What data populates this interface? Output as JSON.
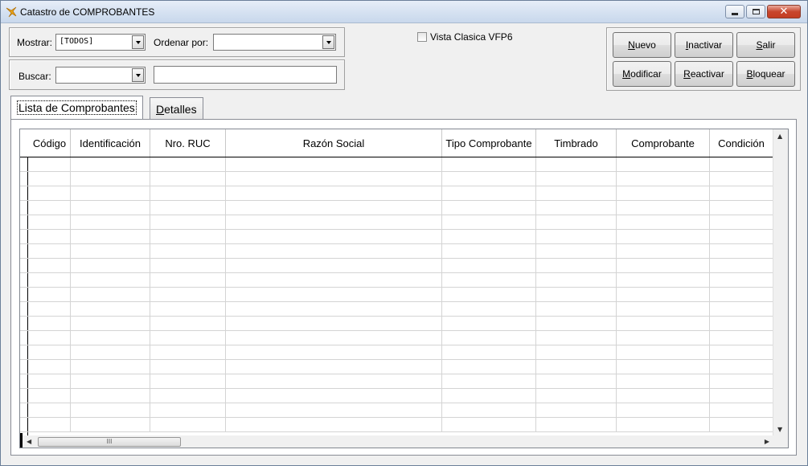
{
  "window": {
    "title": "Catastro de COMPROBANTES",
    "close_glyph": "✕"
  },
  "filters": {
    "mostrar_label": "Mostrar:",
    "mostrar_value": "[TODOS]",
    "ordenar_label": "Ordenar por:",
    "ordenar_value": "",
    "buscar_label": "Buscar:",
    "buscar_value": "",
    "search_text": ""
  },
  "vista_clasica": {
    "label": "Vista Clasica VFP6",
    "checked": false
  },
  "buttons": {
    "nuevo": {
      "hot": "N",
      "rest": "uevo"
    },
    "inactivar": {
      "hot": "I",
      "rest": "nactivar"
    },
    "salir": {
      "hot": "S",
      "rest": "alir"
    },
    "modificar": {
      "hot": "M",
      "rest": "odificar"
    },
    "reactivar": {
      "hot": "R",
      "rest": "eactivar"
    },
    "bloquear": {
      "hot": "B",
      "rest": "loquear"
    }
  },
  "tabs": [
    {
      "label": "Lista de Comprobantes",
      "active": true
    },
    {
      "label_hot": "D",
      "label_rest": "etalles",
      "active": false
    }
  ],
  "grid": {
    "columns": [
      "Código",
      "Identificación",
      "Nro. RUC",
      "Razón Social",
      "Tipo Comprobante",
      "Timbrado",
      "Comprobante",
      "Condición"
    ],
    "thumb_glyph": "III",
    "arrow_up": "▲",
    "arrow_down": "▼",
    "arrow_left": "◀",
    "arrow_right": "▶"
  },
  "colors": {
    "title_gradient_top": "#e7eef8",
    "window_bg": "#f0f0f0",
    "close_red": "#c8452c"
  }
}
